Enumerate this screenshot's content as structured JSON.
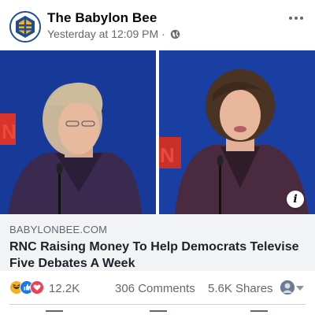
{
  "post": {
    "page_name": "The Babylon Bee",
    "timestamp": "Yesterday at 12:09 PM",
    "separator": "·",
    "privacy_icon": "globe-icon",
    "more_icon": "more-options-icon"
  },
  "link": {
    "domain": "BABYLONBEE.COM",
    "headline": "RNC Raising Money To Help Democrats Televise Five Debates A Week",
    "info_icon": "info-icon",
    "info_glyph": "i"
  },
  "engagement": {
    "reaction_types": [
      "haha",
      "like",
      "love"
    ],
    "reaction_count": "12.2K",
    "comments": "306 Comments",
    "shares": "5.6K Shares"
  },
  "colors": {
    "brand_blue": "#1f4d8f",
    "bee_yellow": "#f5b324",
    "caption_bg": "#f2f3f5",
    "meta_gray": "#65676b",
    "like_blue": "#1877f2",
    "love_red": "#f33e58",
    "haha_yellow": "#f7b125"
  }
}
